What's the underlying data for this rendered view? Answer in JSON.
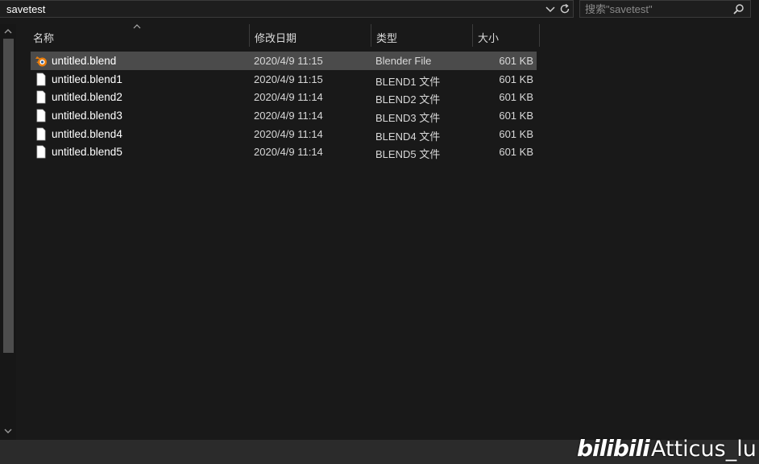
{
  "address_bar": {
    "path": "savetest",
    "search_placeholder": "搜索\"savetest\""
  },
  "columns": {
    "name": "名称",
    "date": "修改日期",
    "type": "类型",
    "size": "大小"
  },
  "files": [
    {
      "name": "untitled.blend",
      "date": "2020/4/9 11:15",
      "type": "Blender File",
      "size": "601 KB",
      "icon": "blender-icon",
      "selected": true
    },
    {
      "name": "untitled.blend1",
      "date": "2020/4/9 11:15",
      "type": "BLEND1 文件",
      "size": "601 KB",
      "icon": "file-icon",
      "selected": false
    },
    {
      "name": "untitled.blend2",
      "date": "2020/4/9 11:14",
      "type": "BLEND2 文件",
      "size": "601 KB",
      "icon": "file-icon",
      "selected": false
    },
    {
      "name": "untitled.blend3",
      "date": "2020/4/9 11:14",
      "type": "BLEND3 文件",
      "size": "601 KB",
      "icon": "file-icon",
      "selected": false
    },
    {
      "name": "untitled.blend4",
      "date": "2020/4/9 11:14",
      "type": "BLEND4 文件",
      "size": "601 KB",
      "icon": "file-icon",
      "selected": false
    },
    {
      "name": "untitled.blend5",
      "date": "2020/4/9 11:14",
      "type": "BLEND5 文件",
      "size": "601 KB",
      "icon": "file-icon",
      "selected": false
    }
  ],
  "watermark": {
    "logo": "bilibili",
    "author": "Atticus_lu"
  },
  "colors": {
    "background": "#191919",
    "selected_row": "#4b4b4b",
    "blender_orange": "#e87d0d"
  }
}
